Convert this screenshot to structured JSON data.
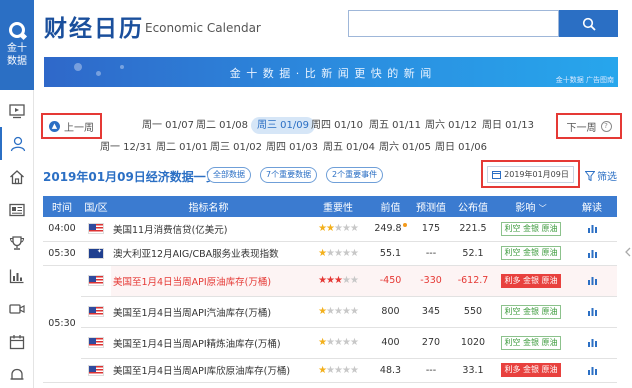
{
  "brand": {
    "name": "金十数据"
  },
  "header": {
    "title": "财经日历",
    "subtitle": "Economic Calendar",
    "search_placeholder": ""
  },
  "banner": {
    "text": "金 十 数 据 · 比 新 闻 更 快 的 新 闻",
    "footnote": "金十数据 广告图南"
  },
  "week_nav": {
    "prev_label": "上一周",
    "next_label": "下一周",
    "days_row1": [
      "周一 01/07",
      "周二 01/08",
      "周三 01/09",
      "周四 01/10",
      "周五 01/11",
      "周六 01/12",
      "周日 01/13"
    ],
    "days_row2": [
      "周一 12/31",
      "周二 01/01",
      "周三 01/02",
      "周四 01/03",
      "周五 01/04",
      "周六 01/05",
      "周日 01/06"
    ],
    "active_day": "周三 01/09"
  },
  "calendar": {
    "title": "2019年01月09日经济数据一览",
    "filters": [
      "全部数据",
      "7个重要数据",
      "2个重要事件"
    ],
    "date_value": "2019年01月09日",
    "filter_label": "筛选"
  },
  "table": {
    "columns": [
      "时间",
      "国/区",
      "指标名称",
      "重要性",
      "前值",
      "预测值",
      "公布值",
      "影响",
      "解读"
    ],
    "rows": [
      {
        "time": "04:00",
        "country": "us",
        "name": "美国11月消费信贷(亿美元)",
        "stars": 2,
        "prev": "249.8",
        "prev_dot": true,
        "forecast": "175",
        "actual": "221.5",
        "impact": "利空 金银 原油",
        "impact_type": "bear",
        "highlight": false
      },
      {
        "time": "05:30",
        "country": "au",
        "name": "澳大利亚12月AIG/CBA服务业表现指数",
        "stars": 1,
        "prev": "55.1",
        "forecast": "---",
        "actual": "52.1",
        "impact": "利空 金银 原油",
        "impact_type": "bear",
        "highlight": false
      },
      {
        "time": "05:30",
        "country": "us",
        "name": "美国至1月4日当周API原油库存(万桶)",
        "stars": 3,
        "prev": "-450",
        "forecast": "-330",
        "actual": "-612.7",
        "impact": "利多 金银 原油",
        "impact_type": "bull",
        "highlight": true
      },
      {
        "time": "",
        "country": "us",
        "name": "美国至1月4日当周API汽油库存(万桶)",
        "stars": 1,
        "prev": "800",
        "forecast": "345",
        "actual": "550",
        "impact": "利空 金银 原油",
        "impact_type": "bear",
        "highlight": false
      },
      {
        "time": "",
        "country": "us",
        "name": "美国至1月4日当周API精炼油库存(万桶)",
        "stars": 1,
        "prev": "400",
        "forecast": "270",
        "actual": "1020",
        "impact": "利空 金银 原油",
        "impact_type": "bear",
        "highlight": false
      },
      {
        "time": "",
        "country": "us",
        "name": "美国至1月4日当周API库欣原油库存(万桶)",
        "stars": 1,
        "prev": "48.3",
        "forecast": "---",
        "actual": "33.1",
        "impact": "利多 金银 原油",
        "impact_type": "bull",
        "highlight": false
      }
    ]
  },
  "colors": {
    "accent": "#2b6fc4",
    "alert": "#e53935",
    "star": "#f3b01c"
  }
}
